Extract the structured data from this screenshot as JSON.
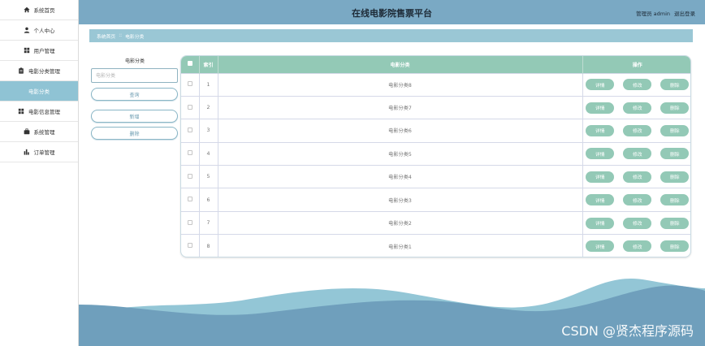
{
  "header": {
    "title": "在线电影院售票平台",
    "admin_label": "管理员 admin",
    "logout_label": "退出登录"
  },
  "sidebar": {
    "items": [
      {
        "label": "系统首页",
        "icon": "home-icon"
      },
      {
        "label": "个人中心",
        "icon": "user-icon"
      },
      {
        "label": "用户管理",
        "icon": "grid-icon"
      },
      {
        "label": "电影分类管理",
        "icon": "clipboard-icon"
      },
      {
        "label": "电影分类",
        "icon": "",
        "active": true
      },
      {
        "label": "电影信息管理",
        "icon": "grid-icon"
      },
      {
        "label": "系统管理",
        "icon": "briefcase-icon"
      },
      {
        "label": "订单管理",
        "icon": "chart-icon"
      }
    ]
  },
  "breadcrumb": {
    "home": "系统首页",
    "separator": "::",
    "current": "电影分类"
  },
  "search": {
    "label": "电影分类",
    "placeholder": "电影分类",
    "query_button": "查询",
    "add_button": "新增",
    "delete_button": "删除"
  },
  "table": {
    "columns": {
      "index": "索引",
      "category": "电影分类",
      "actions": "操作"
    },
    "rows": [
      {
        "index": "1",
        "category": "电影分类8"
      },
      {
        "index": "2",
        "category": "电影分类7"
      },
      {
        "index": "3",
        "category": "电影分类6"
      },
      {
        "index": "4",
        "category": "电影分类5"
      },
      {
        "index": "5",
        "category": "电影分类4"
      },
      {
        "index": "6",
        "category": "电影分类3"
      },
      {
        "index": "7",
        "category": "电影分类2"
      },
      {
        "index": "8",
        "category": "电影分类1"
      }
    ],
    "actions": {
      "detail": "详情",
      "edit": "修改",
      "delete": "删除"
    }
  },
  "watermark": "CSDN @贤杰程序源码",
  "colors": {
    "header": "#7aa9c4",
    "sidebar_active": "#8fc3d4",
    "breadcrumb": "#9ac7d5",
    "table_accent": "#93c9b6",
    "wave_light": "#93c6d6",
    "wave_dark": "#6f9fbc"
  }
}
